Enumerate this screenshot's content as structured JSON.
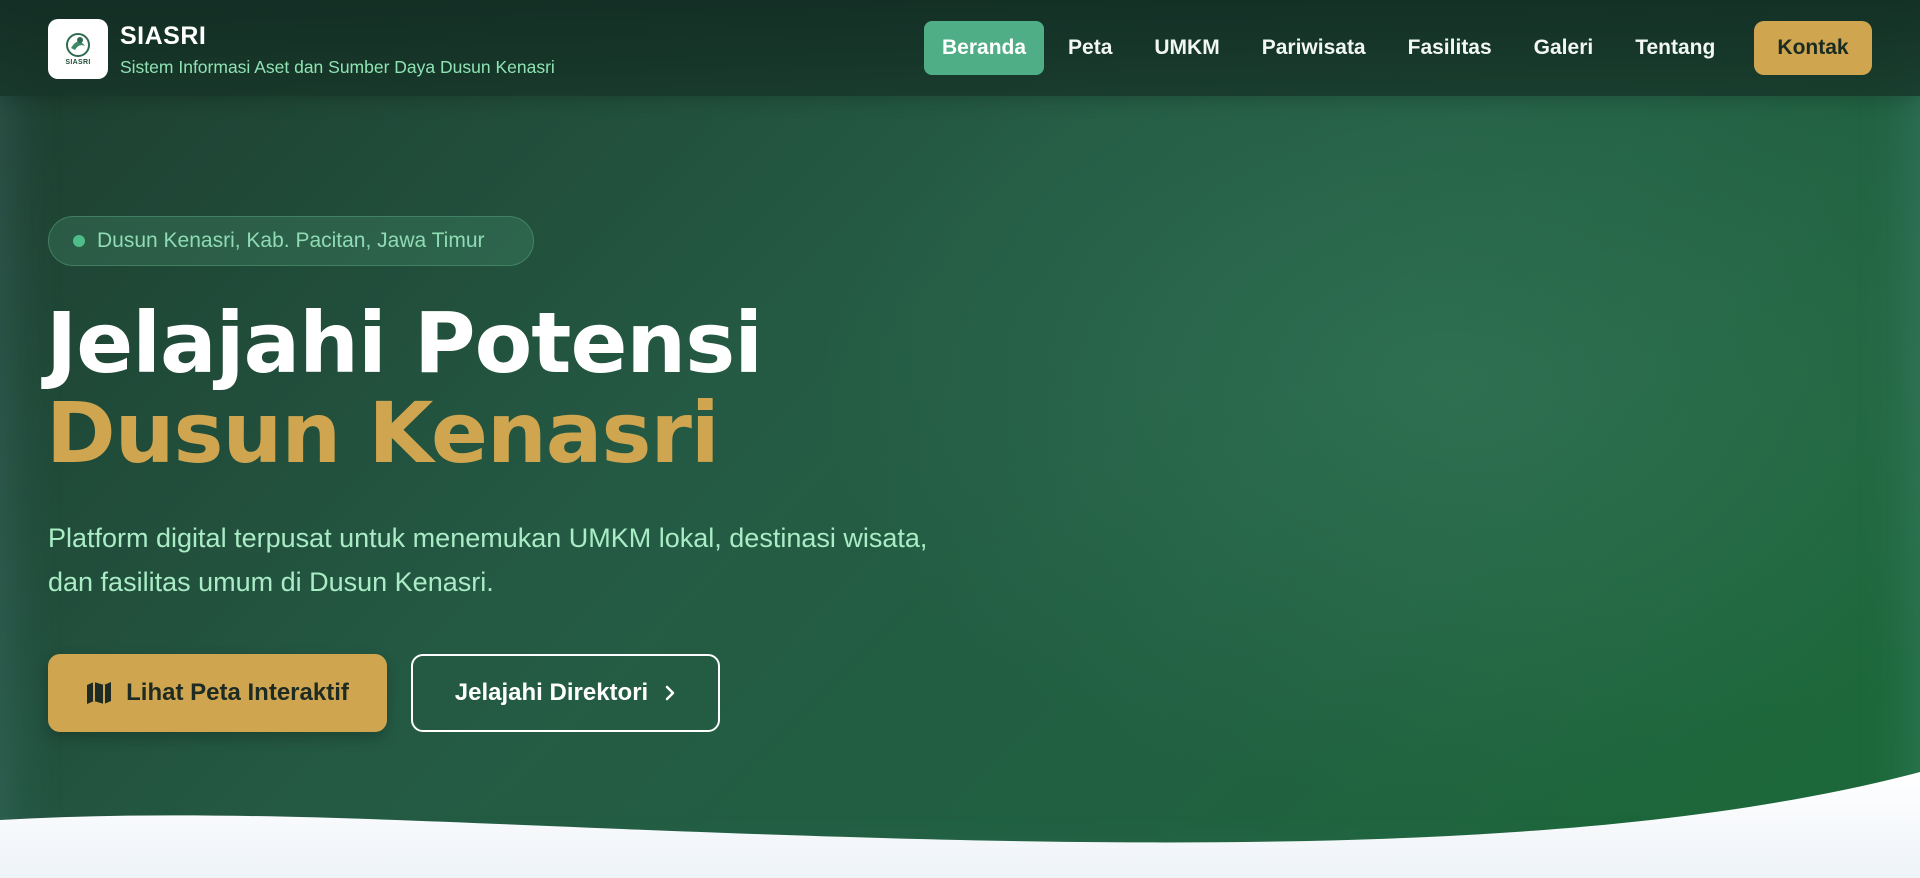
{
  "brand": {
    "logo_text": "SIASRI",
    "title": "SIASRI",
    "subtitle": "Sistem Informasi Aset dan Sumber Daya Dusun Kenasri"
  },
  "nav": {
    "items": [
      {
        "label": "Beranda",
        "active": true
      },
      {
        "label": "Peta",
        "active": false
      },
      {
        "label": "UMKM",
        "active": false
      },
      {
        "label": "Pariwisata",
        "active": false
      },
      {
        "label": "Fasilitas",
        "active": false
      },
      {
        "label": "Galeri",
        "active": false
      },
      {
        "label": "Tentang",
        "active": false
      }
    ],
    "cta_label": "Kontak"
  },
  "hero": {
    "location_badge": "Dusun Kenasri, Kab. Pacitan, Jawa Timur",
    "headline_line1": "Jelajahi Potensi",
    "headline_line2": "Dusun Kenasri",
    "lead": "Platform digital terpusat untuk menemukan UMKM lokal, destinasi wisata, dan fasilitas umum di Dusun Kenasri.",
    "primary_button": "Lihat Peta Interaktif",
    "secondary_button": "Jelajahi Direktori"
  },
  "icons": {
    "map": "map-icon",
    "chevron": "chevron-right-icon",
    "location_dot": "status-dot"
  },
  "colors": {
    "accent_gold": "#cfa54f",
    "accent_green": "#4fae85",
    "hero_dark": "#1d3d2f",
    "subtitle_green": "#8fe3b3"
  }
}
